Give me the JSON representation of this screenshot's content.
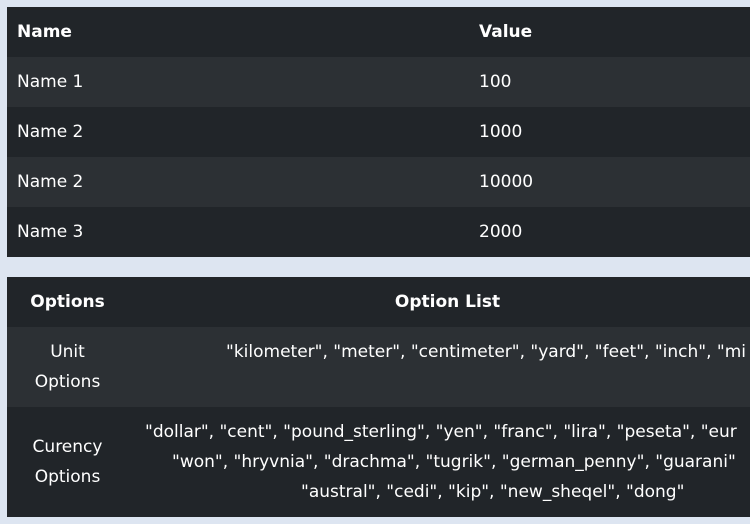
{
  "values_table": {
    "headers": {
      "name": "Name",
      "value": "Value"
    },
    "rows": [
      {
        "name": "Name 1",
        "value": "100"
      },
      {
        "name": "Name 2",
        "value": "1000"
      },
      {
        "name": "Name 2",
        "value": "10000"
      },
      {
        "name": "Name 3",
        "value": "2000"
      }
    ]
  },
  "options_table": {
    "headers": {
      "options": "Options",
      "list": "Option List"
    },
    "rows": [
      {
        "label_line1": "Unit",
        "label_line2": "Options",
        "list": "\"kilometer\", \"meter\", \"centimeter\", \"yard\", \"feet\", \"inch\", \"mi"
      },
      {
        "label_line1": "Curency",
        "label_line2": "Options",
        "list_line1": "\"dollar\", \"cent\", \"pound_sterling\", \"yen\", \"franc\", \"lira\", \"peseta\", \"eur",
        "list_line2": "\"won\", \"hryvnia\", \"drachma\", \"tugrik\", \"german_penny\", \"guarani\"",
        "list_line3": "\"austral\", \"cedi\", \"kip\", \"new_sheqel\", \"dong\""
      }
    ]
  },
  "colors": {
    "page_background": "#dde5f1",
    "table_dark": "#212529",
    "table_stripe": "#2c3034",
    "text": "#ffffff"
  }
}
